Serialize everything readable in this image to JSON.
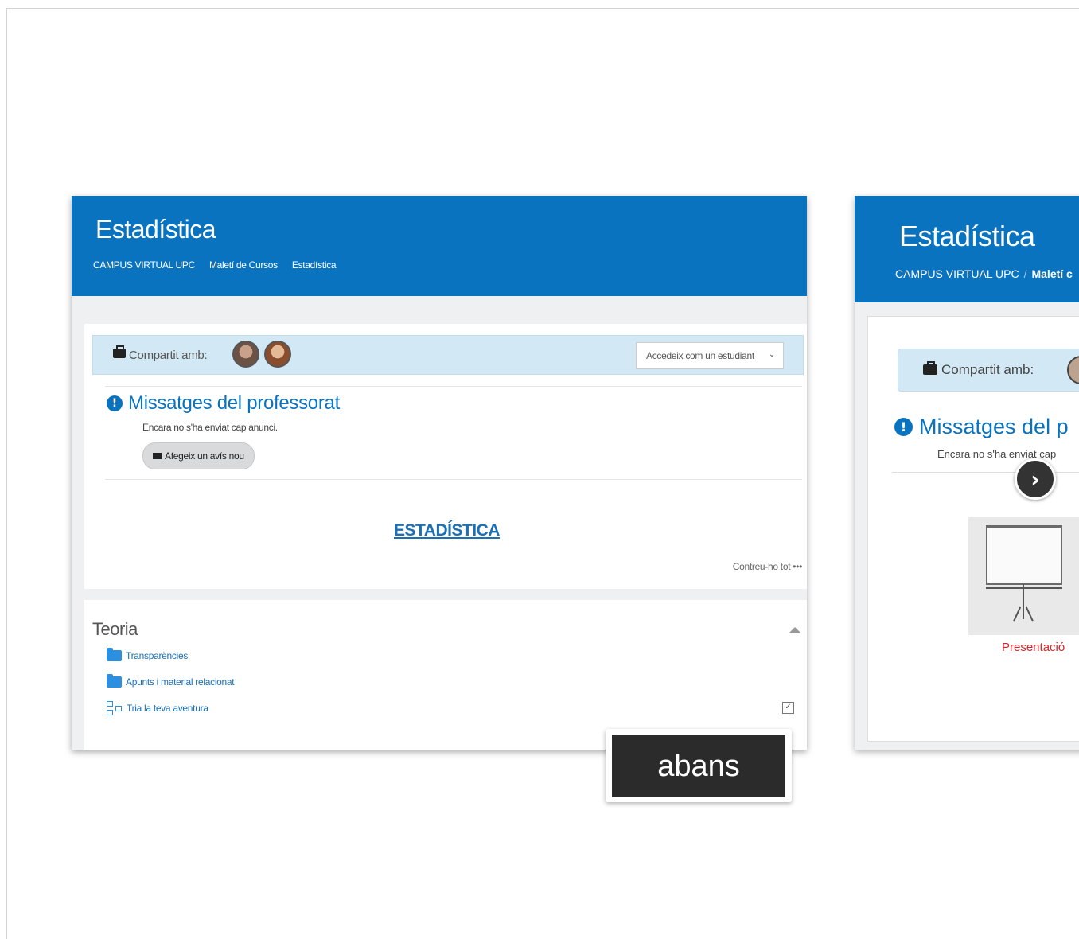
{
  "before": {
    "course_title": "Estadística",
    "breadcrumb": [
      "CAMPUS VIRTUAL UPC",
      "Maletí de Cursos",
      "Estadística"
    ],
    "shared_label": "Compartit amb:",
    "view_as_select": "Accedeix com un estudiant",
    "messages_heading": "Missatges del professorat",
    "no_announcements": "Encara no s'ha enviat cap anunci.",
    "add_notice_button": "Afegeix un avís nou",
    "course_link": "ESTADÍSTICA",
    "collapse_all": "Contreu-ho tot",
    "section_title": "Teoria",
    "resources": [
      "Transparències",
      "Apunts i material relacionat",
      "Tria la teva aventura"
    ],
    "badge": "abans"
  },
  "after": {
    "course_title": "Estadística",
    "breadcrumb_first": "CAMPUS VIRTUAL UPC",
    "breadcrumb_second": "Maletí c",
    "shared_label": "Compartit amb:",
    "messages_heading": "Missatges del p",
    "no_announcements": "Encara no s'ha enviat cap",
    "presentation_label": "Presentació"
  },
  "colors": {
    "header_blue": "#0a73c0",
    "info_bar": "#d2e9f5",
    "link_red": "#d9262b"
  }
}
